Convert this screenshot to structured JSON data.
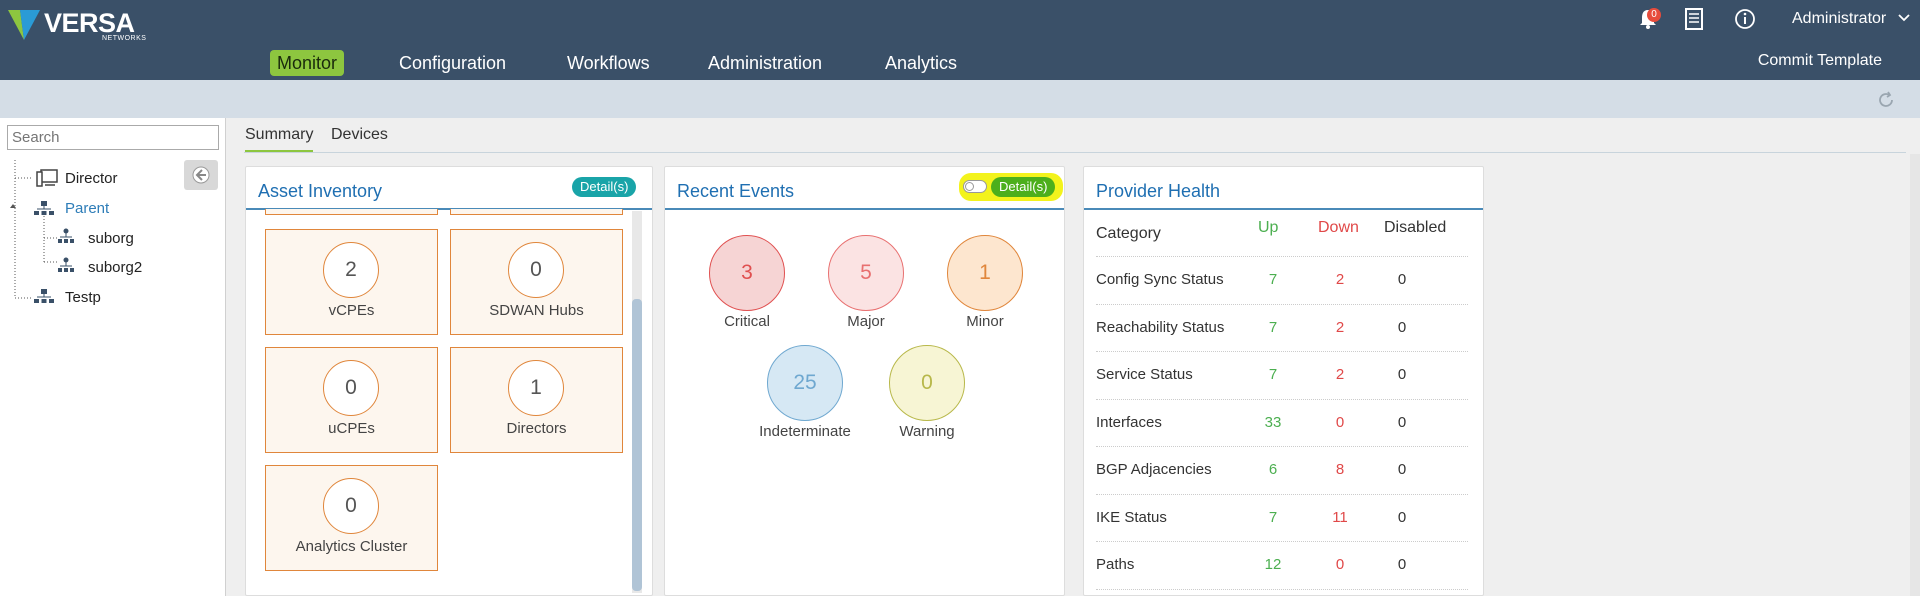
{
  "header": {
    "logo_text": "VERSA",
    "logo_sub": "NETWORKS",
    "notification_count": "0",
    "user": "Administrator",
    "nav": [
      "Monitor",
      "Configuration",
      "Workflows",
      "Administration",
      "Analytics"
    ],
    "commit": "Commit Template"
  },
  "sidebar": {
    "search_placeholder": "Search",
    "items": [
      {
        "label": "Director"
      },
      {
        "label": "Parent"
      },
      {
        "label": "suborg"
      },
      {
        "label": "suborg2"
      },
      {
        "label": "Testp"
      }
    ]
  },
  "tabs": [
    "Summary",
    "Devices"
  ],
  "asset_inventory": {
    "title": "Asset Inventory",
    "detail": "Detail(s)",
    "tiles": [
      {
        "value": "2",
        "label": "vCPEs"
      },
      {
        "value": "0",
        "label": "SDWAN Hubs"
      },
      {
        "value": "0",
        "label": "uCPEs"
      },
      {
        "value": "1",
        "label": "Directors"
      },
      {
        "value": "0",
        "label": "Analytics Cluster"
      }
    ]
  },
  "recent_events": {
    "title": "Recent Events",
    "detail": "Detail(s)",
    "events": [
      {
        "value": "3",
        "label": "Critical",
        "color": "#e05050",
        "fill": "#f6d4d4"
      },
      {
        "value": "5",
        "label": "Major",
        "color": "#e87070",
        "fill": "#fbe3e3"
      },
      {
        "value": "1",
        "label": "Minor",
        "color": "#e0863b",
        "fill": "#fde6cf"
      },
      {
        "value": "25",
        "label": "Indeterminate",
        "color": "#6fa8d0",
        "fill": "#d6e8f4"
      },
      {
        "value": "0",
        "label": "Warning",
        "color": "#b8b84a",
        "fill": "#f7f5d4"
      }
    ]
  },
  "provider_health": {
    "title": "Provider Health",
    "headers": [
      "Category",
      "Up",
      "Down",
      "Disabled"
    ],
    "rows": [
      {
        "category": "Config Sync Status",
        "up": "7",
        "down": "2",
        "disabled": "0"
      },
      {
        "category": "Reachability Status",
        "up": "7",
        "down": "2",
        "disabled": "0"
      },
      {
        "category": "Service Status",
        "up": "7",
        "down": "2",
        "disabled": "0"
      },
      {
        "category": "Interfaces",
        "up": "33",
        "down": "0",
        "disabled": "0"
      },
      {
        "category": "BGP Adjacencies",
        "up": "6",
        "down": "8",
        "disabled": "0"
      },
      {
        "category": "IKE Status",
        "up": "7",
        "down": "11",
        "disabled": "0"
      },
      {
        "category": "Paths",
        "up": "12",
        "down": "0",
        "disabled": "0"
      }
    ]
  },
  "colors": {
    "up": "#4caf50",
    "down": "#e04848",
    "accent": "#8dc63f"
  }
}
